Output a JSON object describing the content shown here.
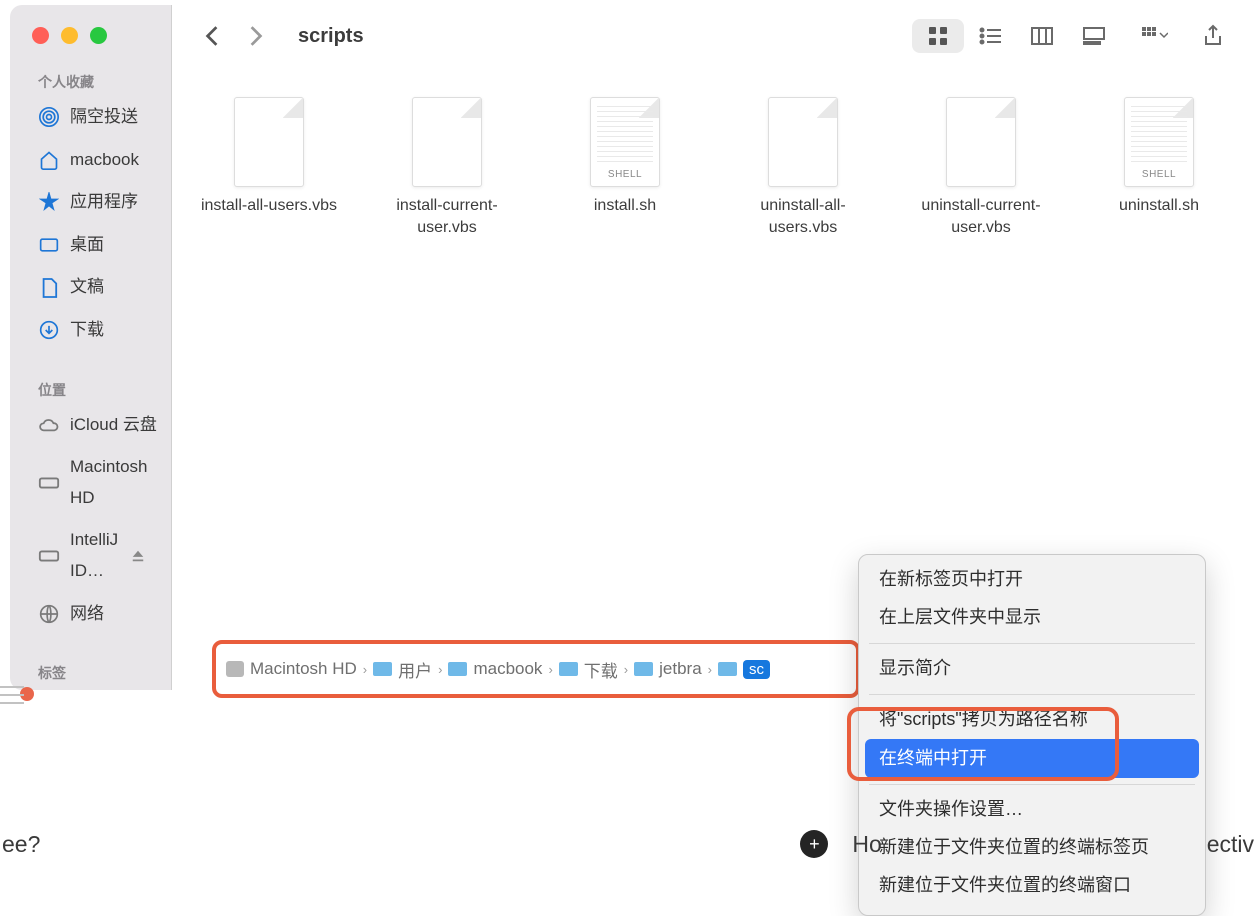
{
  "window": {
    "title": "scripts"
  },
  "sidebar": {
    "sections": [
      {
        "label": "个人收藏",
        "items": [
          {
            "icon": "airdrop-icon",
            "label": "隔空投送"
          },
          {
            "icon": "home-icon",
            "label": "macbook"
          },
          {
            "icon": "apps-icon",
            "label": "应用程序"
          },
          {
            "icon": "desktop-icon",
            "label": "桌面"
          },
          {
            "icon": "document-icon",
            "label": "文稿"
          },
          {
            "icon": "download-icon",
            "label": "下载"
          }
        ]
      },
      {
        "label": "位置",
        "items": [
          {
            "icon": "cloud-icon",
            "label": "iCloud 云盘",
            "dim": true
          },
          {
            "icon": "disk-icon",
            "label": "Macintosh HD",
            "dim": true
          },
          {
            "icon": "disk-icon",
            "label": "IntelliJ ID…",
            "dim": true,
            "eject": true
          },
          {
            "icon": "globe-icon",
            "label": "网络",
            "dim": true
          }
        ]
      },
      {
        "label": "标签",
        "items": []
      }
    ]
  },
  "files": [
    {
      "name": "install-all-users.vbs",
      "type": "blank"
    },
    {
      "name": "install-current-user.vbs",
      "type": "blank"
    },
    {
      "name": "install.sh",
      "type": "shell"
    },
    {
      "name": "uninstall-all-users.vbs",
      "type": "blank"
    },
    {
      "name": "uninstall-current-user.vbs",
      "type": "blank"
    },
    {
      "name": "uninstall.sh",
      "type": "shell"
    }
  ],
  "pathbar": {
    "crumbs": [
      {
        "icon": "hd",
        "label": "Macintosh HD"
      },
      {
        "icon": "teal",
        "label": "用户"
      },
      {
        "icon": "teal",
        "label": "macbook"
      },
      {
        "icon": "teal",
        "label": "下载"
      },
      {
        "icon": "blue",
        "label": "jetbra"
      },
      {
        "icon": "blue",
        "label": "sc",
        "current": true
      }
    ]
  },
  "context_menu": {
    "items": [
      {
        "label": "在新标签页中打开"
      },
      {
        "label": "在上层文件夹中显示"
      },
      {
        "sep": true
      },
      {
        "label": "显示简介"
      },
      {
        "sep": true
      },
      {
        "label": "将\"scripts\"拷贝为路径名称"
      },
      {
        "label": "在终端中打开",
        "highlight": true
      },
      {
        "sep": true
      },
      {
        "label": "文件夹操作设置…"
      },
      {
        "label": "新建位于文件夹位置的终端标签页"
      },
      {
        "label": "新建位于文件夹位置的终端窗口"
      }
    ]
  },
  "bottom": {
    "left_fragment": "ee?",
    "mid_fragment": "Ho",
    "right_fragment": "ectiv"
  }
}
